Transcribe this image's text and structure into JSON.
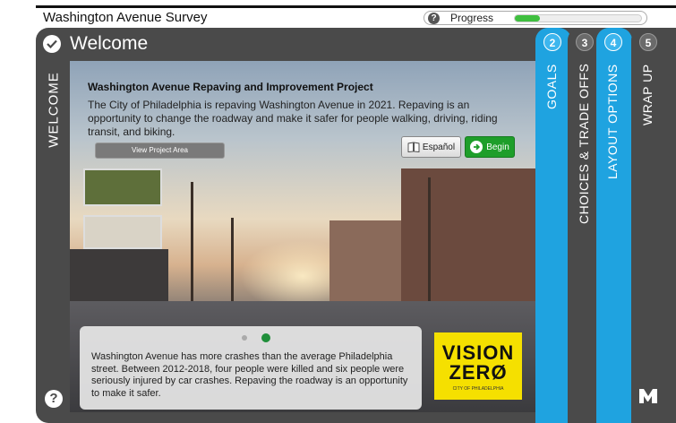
{
  "header": {
    "survey_title": "Washington Avenue Survey",
    "progress_label": "Progress",
    "progress_help": "?",
    "progress_value": 0.2
  },
  "welcome": {
    "title": "Welcome",
    "side_label": "WELCOME",
    "help": "?"
  },
  "intro": {
    "title": "Washington Avenue Repaving and Improvement Project",
    "body": "The City of Philadelphia is repaving Washington Avenue in 2021. Repaving is an opportunity to change the roadway and make it safer for people walking, driving, riding transit, and biking.",
    "view_area_label": "View Project Area",
    "espanol_label": "Español",
    "begin_label": "Begin"
  },
  "stat": {
    "text": "Washington Avenue has more crashes than the average Philadelphia street. Between 2012-2018, four people were killed and six people were seriously injured by car crashes. Repaving the roadway is an opportunity to make it safer."
  },
  "logo": {
    "line1": "VISION",
    "line2": "ZERØ",
    "line3": "CITY OF PHILADELPHIA"
  },
  "steps": [
    {
      "num": "2",
      "label": "GOALS"
    },
    {
      "num": "3",
      "label": "CHOICES & TRADE OFFS"
    },
    {
      "num": "4",
      "label": "LAYOUT OPTIONS"
    },
    {
      "num": "5",
      "label": "WRAP UP"
    }
  ],
  "colors": {
    "accent_blue": "#1fa3e0",
    "panel_gray": "#4a4a4a",
    "begin_green": "#1e9e2a",
    "progress_green": "#3fbf3f",
    "logo_yellow": "#f5e000"
  }
}
